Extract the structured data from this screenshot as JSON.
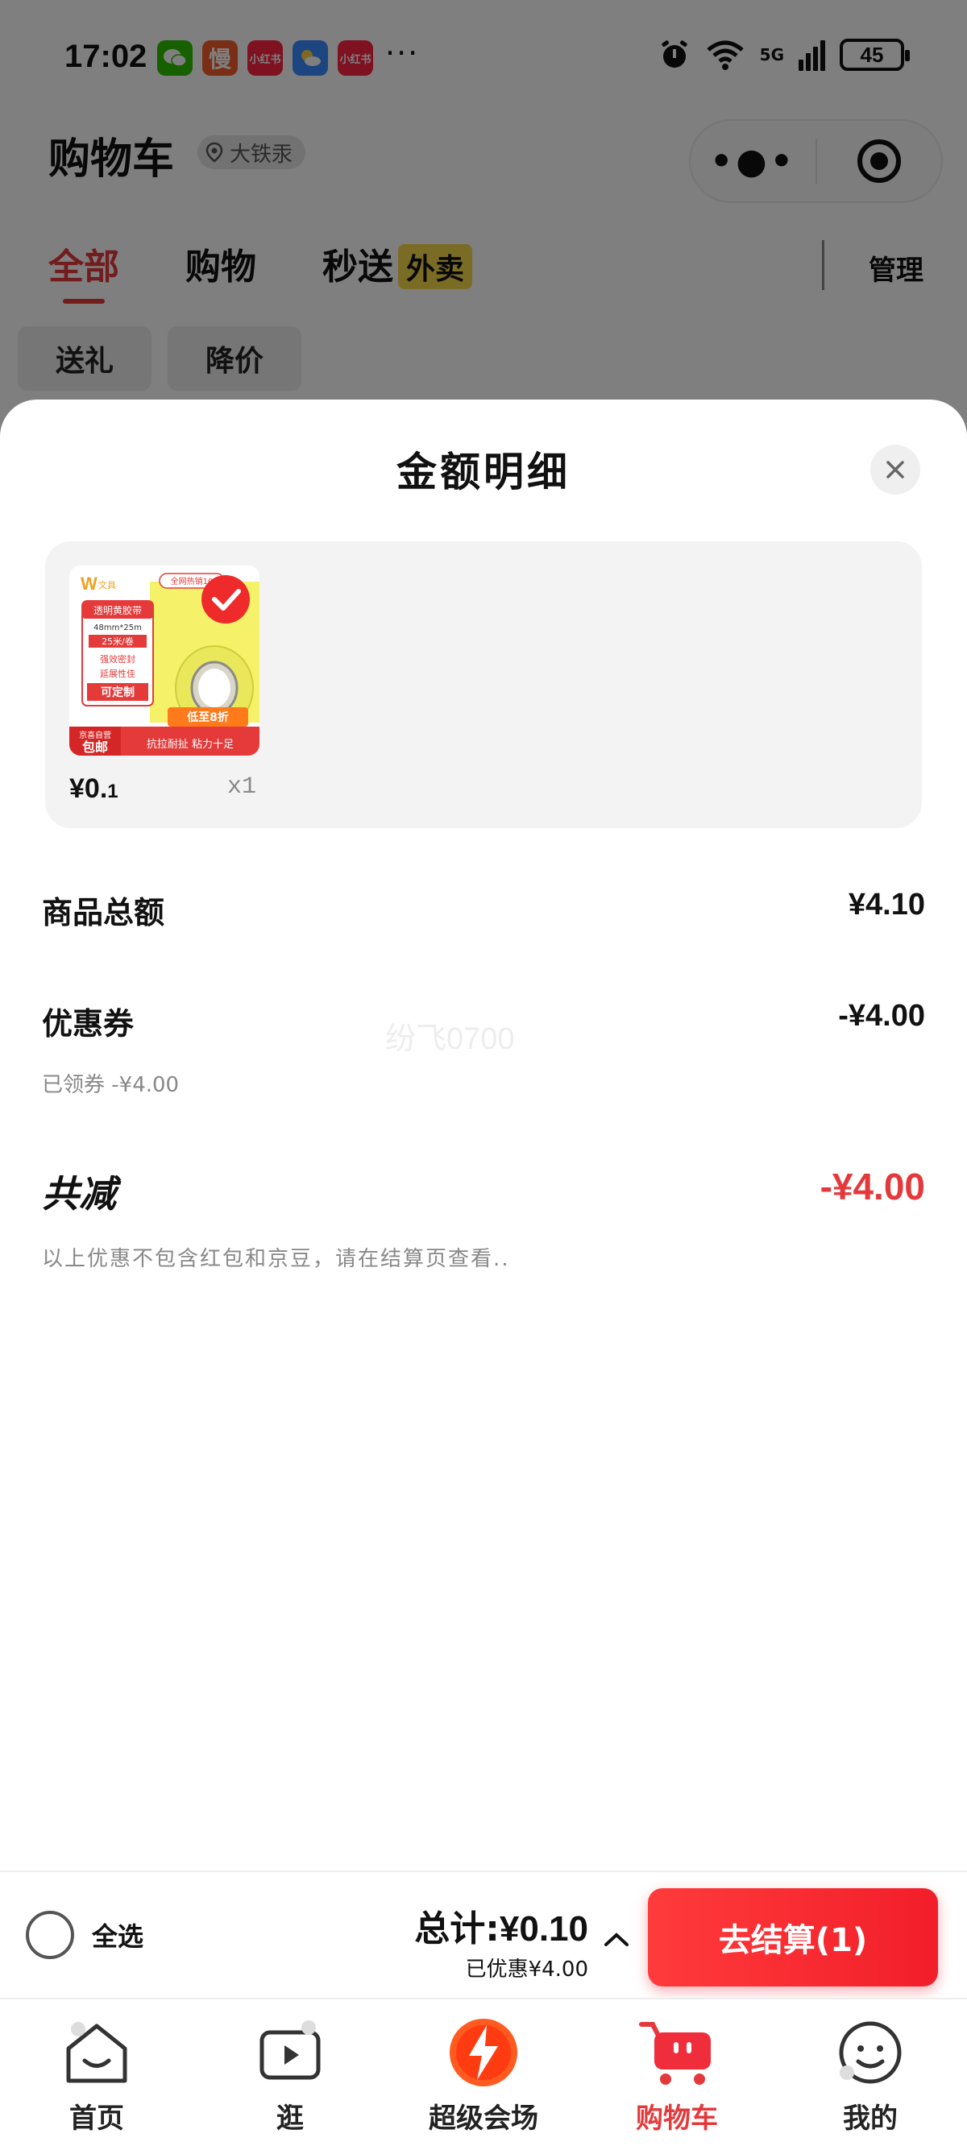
{
  "status_bar": {
    "time": "17:02",
    "apps": [
      {
        "name": "wechat-icon",
        "text": "",
        "color": "#2dc100"
      },
      {
        "name": "manga-app-icon",
        "text": "慢",
        "color": "#f25c2a"
      },
      {
        "name": "xiaohongshu-icon",
        "text": "小红书",
        "color": "#ff2442"
      },
      {
        "name": "weather-icon",
        "text": "",
        "color": "#3a8bff"
      },
      {
        "name": "xiaohongshu-icon-2",
        "text": "小红书",
        "color": "#ff2442"
      }
    ],
    "more": "···",
    "network": "5G",
    "battery": "45"
  },
  "header": {
    "title": "购物车",
    "location": "大铁汞"
  },
  "tabs": [
    {
      "label": "全部",
      "active": true
    },
    {
      "label": "购物",
      "active": false
    },
    {
      "label": "秒送",
      "badge": "外卖",
      "active": false
    }
  ],
  "manage_label": "管理",
  "filters": [
    "送礼",
    "降价"
  ],
  "sheet": {
    "title": "金额明细",
    "product": {
      "price_main": "¥0.",
      "price_small": "1",
      "qty": "x1",
      "thumb": {
        "brand": "文具",
        "lines": [
          "透明黄胶带",
          "48mm*25m",
          "25米/卷",
          "强效密封",
          "延展性佳",
          "可定制"
        ],
        "tag": "全网热销10",
        "promo": "低至8折",
        "bottom_left_1": "京喜自营",
        "bottom_left_2": "包邮",
        "bottom_right": "抗拉耐扯 粘力十足"
      }
    },
    "rows": [
      {
        "label": "商品总额",
        "value": "¥4.10"
      },
      {
        "label": "优惠券",
        "value": "-¥4.00",
        "sub": "已领券 -¥4.00"
      }
    ],
    "total": {
      "label": "共减",
      "value": "-¥4.00"
    },
    "note": "以上优惠不包含红包和京豆，请在结算页查看..",
    "watermark": "纷飞0700"
  },
  "checkout": {
    "select_all": "全选",
    "total_prefix": "总计:",
    "total_amount": "¥0.10",
    "discount": "已优惠¥4.00",
    "button": "去结算(1)"
  },
  "tabbar": [
    {
      "label": "首页",
      "icon": "home-icon",
      "active": false
    },
    {
      "label": "逛",
      "icon": "video-icon",
      "active": false
    },
    {
      "label": "超级会场",
      "icon": "super-venue-icon",
      "active": false
    },
    {
      "label": "购物车",
      "icon": "cart-icon",
      "active": true
    },
    {
      "label": "我的",
      "icon": "profile-icon",
      "active": false
    }
  ],
  "colors": {
    "accent": "#e4393c",
    "overlay": "rgba(0,0,0,0.5)",
    "card_bg": "#f3f3f3"
  }
}
